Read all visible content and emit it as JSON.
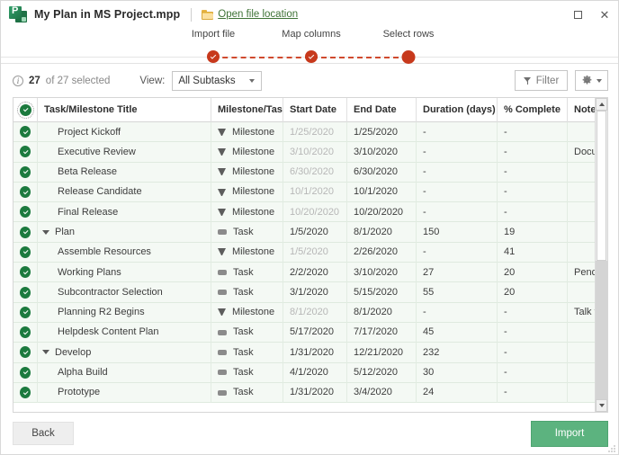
{
  "window": {
    "title": "My Plan in MS Project.mpp",
    "app_icon": "ms-project-icon",
    "open_location_label": "Open file location",
    "maximize_label": "□",
    "close_label": "✕"
  },
  "stepper": {
    "steps": [
      {
        "label": "Import file",
        "state": "done"
      },
      {
        "label": "Map columns",
        "state": "done"
      },
      {
        "label": "Select rows",
        "state": "current"
      }
    ],
    "accent_color": "#c7391c"
  },
  "toolbar": {
    "selected_count": "27",
    "selected_suffix": "of 27 selected",
    "view_label": "View:",
    "view_value": "All Subtasks",
    "filter_label": "Filter",
    "settings_icon": "gear-icon"
  },
  "table": {
    "columns": [
      "Task/Milestone Title",
      "Milestone/Task",
      "Start Date",
      "End Date",
      "Duration (days)",
      "% Complete",
      "Notes"
    ],
    "rows": [
      {
        "checked": true,
        "indent": 1,
        "group": false,
        "title": "Project Kickoff",
        "type": "Milestone",
        "type_icon": "milestone-icon",
        "start": "1/25/2020",
        "start_muted": true,
        "end": "1/25/2020",
        "duration": "-",
        "percent": "-",
        "notes": ""
      },
      {
        "checked": true,
        "indent": 1,
        "group": false,
        "title": "Executive Review",
        "type": "Milestone",
        "type_icon": "milestone-icon",
        "start": "3/10/2020",
        "start_muted": true,
        "end": "3/10/2020",
        "duration": "-",
        "percent": "-",
        "notes": "Documentati..."
      },
      {
        "checked": true,
        "indent": 1,
        "group": false,
        "title": "Beta Release",
        "type": "Milestone",
        "type_icon": "milestone-icon",
        "start": "6/30/2020",
        "start_muted": true,
        "end": "6/30/2020",
        "duration": "-",
        "percent": "-",
        "notes": ""
      },
      {
        "checked": true,
        "indent": 1,
        "group": false,
        "title": "Release Candidate",
        "type": "Milestone",
        "type_icon": "milestone-icon",
        "start": "10/1/2020",
        "start_muted": true,
        "end": "10/1/2020",
        "duration": "-",
        "percent": "-",
        "notes": ""
      },
      {
        "checked": true,
        "indent": 1,
        "group": false,
        "title": "Final Release",
        "type": "Milestone",
        "type_icon": "milestone-icon",
        "start": "10/20/2020",
        "start_muted": true,
        "end": "10/20/2020",
        "duration": "-",
        "percent": "-",
        "notes": ""
      },
      {
        "checked": true,
        "indent": 0,
        "group": true,
        "title": "Plan",
        "type": "Task",
        "type_icon": "task-icon",
        "start": "1/5/2020",
        "start_muted": false,
        "end": "8/1/2020",
        "duration": "150",
        "percent": "19",
        "notes": ""
      },
      {
        "checked": true,
        "indent": 1,
        "group": false,
        "title": "Assemble Resources",
        "type": "Milestone",
        "type_icon": "milestone-icon",
        "start": "1/5/2020",
        "start_muted": true,
        "end": "2/26/2020",
        "duration": "-",
        "percent": "41",
        "notes": ""
      },
      {
        "checked": true,
        "indent": 1,
        "group": false,
        "title": "Working Plans",
        "type": "Task",
        "type_icon": "task-icon",
        "start": "2/2/2020",
        "start_muted": false,
        "end": "3/10/2020",
        "duration": "27",
        "percent": "20",
        "notes": "Pending app..."
      },
      {
        "checked": true,
        "indent": 1,
        "group": false,
        "title": "Subcontractor Selection",
        "type": "Task",
        "type_icon": "task-icon",
        "start": "3/1/2020",
        "start_muted": false,
        "end": "5/15/2020",
        "duration": "55",
        "percent": "20",
        "notes": ""
      },
      {
        "checked": true,
        "indent": 1,
        "group": false,
        "title": "Planning R2 Begins",
        "type": "Milestone",
        "type_icon": "milestone-icon",
        "start": "8/1/2020",
        "start_muted": true,
        "end": "8/1/2020",
        "duration": "-",
        "percent": "-",
        "notes": "Talk to Dan a..."
      },
      {
        "checked": true,
        "indent": 1,
        "group": false,
        "title": "Helpdesk Content Plan",
        "type": "Task",
        "type_icon": "task-icon",
        "start": "5/17/2020",
        "start_muted": false,
        "end": "7/17/2020",
        "duration": "45",
        "percent": "-",
        "notes": ""
      },
      {
        "checked": true,
        "indent": 0,
        "group": true,
        "title": "Develop",
        "type": "Task",
        "type_icon": "task-icon",
        "start": "1/31/2020",
        "start_muted": false,
        "end": "12/21/2020",
        "duration": "232",
        "percent": "-",
        "notes": ""
      },
      {
        "checked": true,
        "indent": 1,
        "group": false,
        "title": "Alpha Build",
        "type": "Task",
        "type_icon": "task-icon",
        "start": "4/1/2020",
        "start_muted": false,
        "end": "5/12/2020",
        "duration": "30",
        "percent": "-",
        "notes": ""
      },
      {
        "checked": true,
        "indent": 1,
        "group": false,
        "title": "Prototype",
        "type": "Task",
        "type_icon": "task-icon",
        "start": "1/31/2020",
        "start_muted": false,
        "end": "3/4/2020",
        "duration": "24",
        "percent": "-",
        "notes": ""
      }
    ]
  },
  "footer": {
    "back_label": "Back",
    "import_label": "Import",
    "import_color": "#5cb37f"
  }
}
